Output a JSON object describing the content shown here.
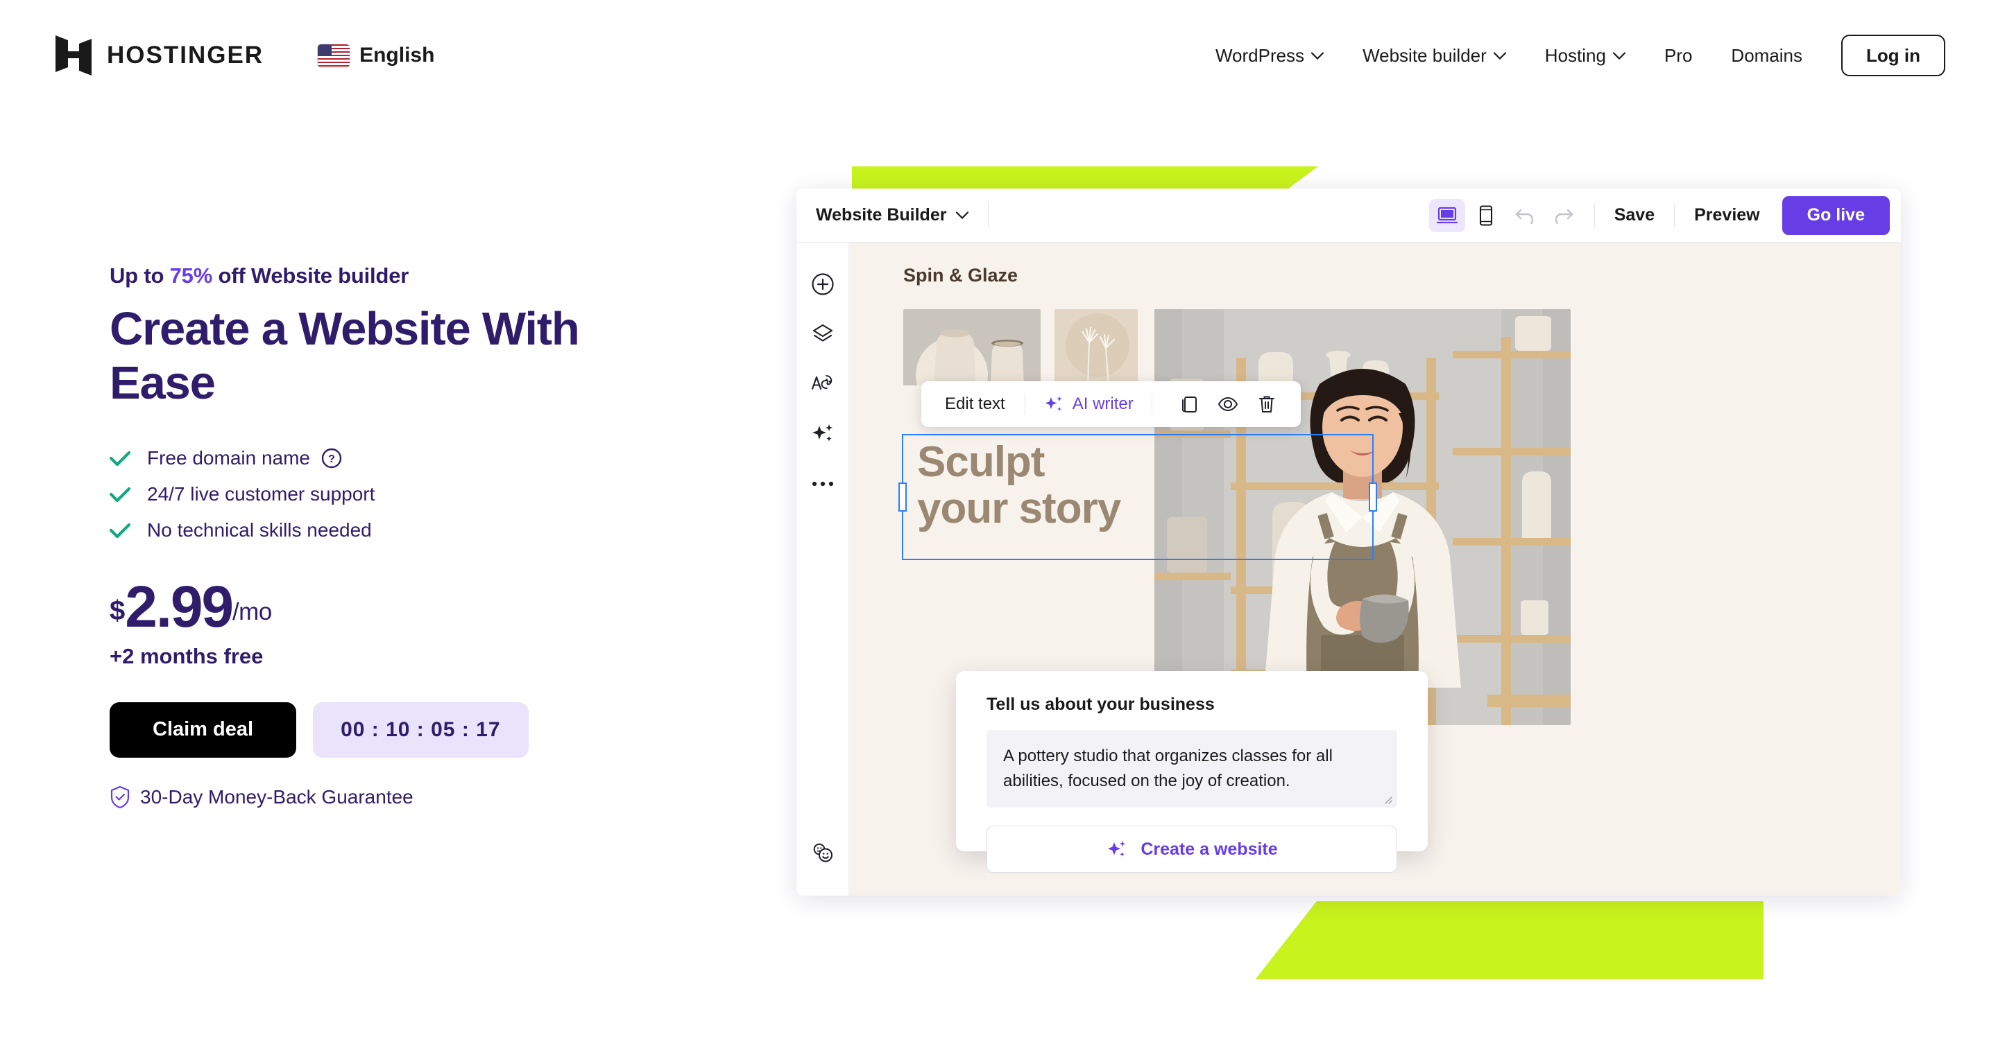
{
  "header": {
    "brand_name": "HOSTINGER",
    "language": "English",
    "nav_items": [
      {
        "label": "WordPress",
        "has_chevron": true
      },
      {
        "label": "Website builder",
        "has_chevron": true
      },
      {
        "label": "Hosting",
        "has_chevron": true
      },
      {
        "label": "Pro",
        "has_chevron": false
      },
      {
        "label": "Domains",
        "has_chevron": false
      }
    ],
    "login_label": "Log in"
  },
  "hero": {
    "eyebrow_before": "Up to ",
    "eyebrow_highlight": "75%",
    "eyebrow_after": " off Website builder",
    "headline": "Create a Website With Ease",
    "features": [
      {
        "label": "Free domain name",
        "has_help": true
      },
      {
        "label": "24/7 live customer support",
        "has_help": false
      },
      {
        "label": "No technical skills needed",
        "has_help": false
      }
    ],
    "currency": "$",
    "amount": "2.99",
    "period": "/mo",
    "bonus": "+2 months free",
    "cta_label": "Claim deal",
    "timer": "00 : 10 : 05 : 17",
    "guarantee": "30-Day Money-Back Guarantee"
  },
  "builder": {
    "title": "Website Builder",
    "save_label": "Save",
    "preview_label": "Preview",
    "golive_label": "Go live",
    "sidebar_icons": [
      "add-circle-icon",
      "layers-icon",
      "style-palette-icon",
      "ai-sparkle-icon",
      "more-options-icon"
    ],
    "feedback_icon": "feedback-faces-icon",
    "site_brand": "Spin & Glaze",
    "selected_heading": "Sculpt\nyour story",
    "edit_toolbar": {
      "edit_text_label": "Edit text",
      "ai_writer_label": "AI writer",
      "icons": [
        "duplicate-icon",
        "visibility-icon",
        "delete-icon"
      ]
    },
    "ai_panel": {
      "label": "Tell us about your business",
      "value": "A pottery studio that organizes classes for all abilities, focused on the joy of creation.",
      "button_label": "Create a website"
    }
  },
  "colors": {
    "brand_purple": "#673DE6",
    "deep_purple": "#2F1C6A",
    "lime": "#C9F31D",
    "green_tick": "#0FA97F",
    "canvas_cream": "#F7F2EC",
    "heading_taupe": "#9A8872",
    "selection_blue": "#2B7FFF"
  }
}
